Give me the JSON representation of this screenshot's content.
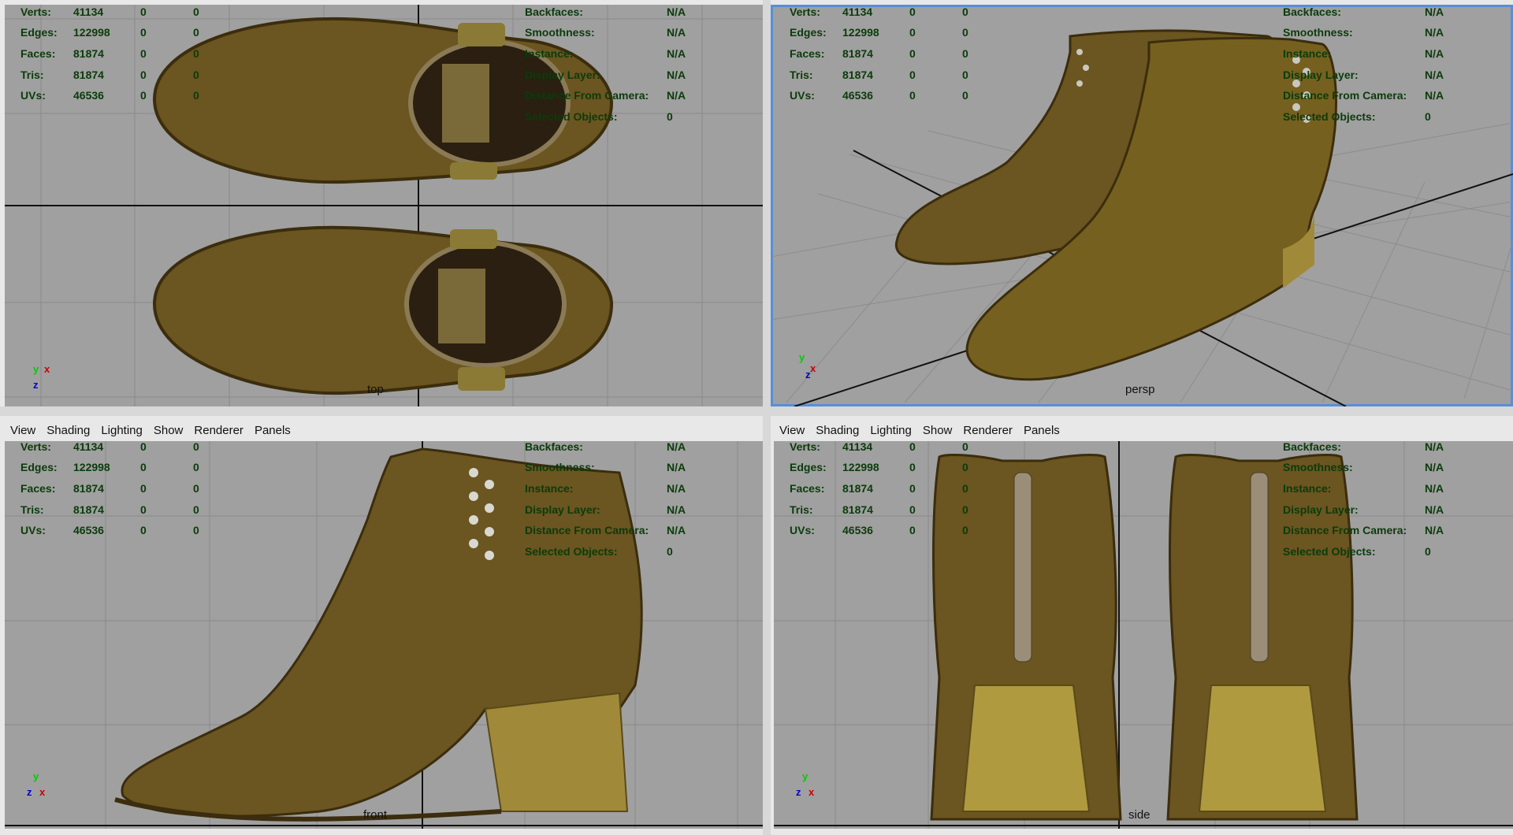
{
  "menu": [
    "View",
    "Shading",
    "Lighting",
    "Show",
    "Renderer",
    "Panels"
  ],
  "hud_left": {
    "labels": [
      "Verts:",
      "Edges:",
      "Faces:",
      "Tris:",
      "UVs:"
    ],
    "values": [
      [
        "41134",
        "0",
        "0"
      ],
      [
        "122998",
        "0",
        "0"
      ],
      [
        "81874",
        "0",
        "0"
      ],
      [
        "81874",
        "0",
        "0"
      ],
      [
        "46536",
        "0",
        "0"
      ]
    ]
  },
  "hud_right": {
    "labels": [
      "Backfaces:",
      "Smoothness:",
      "Instance:",
      "Display Layer:",
      "Distance From Camera:",
      "Selected Objects:"
    ],
    "values": [
      "N/A",
      "N/A",
      "N/A",
      "N/A",
      "N/A",
      "0"
    ]
  },
  "viewports": [
    {
      "camera": "top"
    },
    {
      "camera": "persp"
    },
    {
      "camera": "front"
    },
    {
      "camera": "side"
    }
  ],
  "axis_labels": {
    "x": "x",
    "y": "y",
    "z": "z"
  },
  "colors": {
    "viewport_bg": "#a0a0a0",
    "hud_text": "#0b3b0b",
    "active_border": "#5a8ed6",
    "leather": "#6b5520",
    "heel": "#a08a3a"
  }
}
